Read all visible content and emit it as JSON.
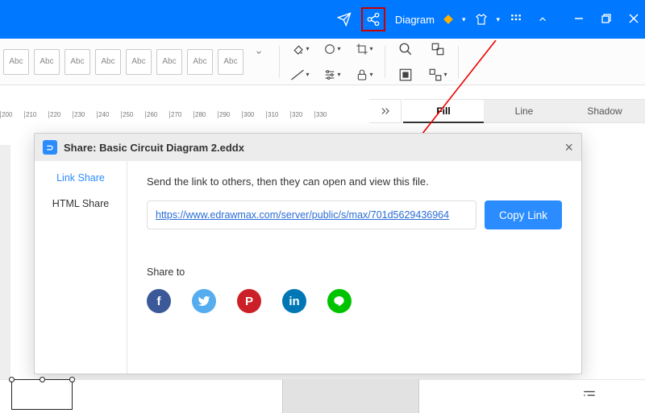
{
  "titlebar": {
    "diagram_label": "Diagram"
  },
  "ribbon": {
    "abc_label": "Abc",
    "abc_count": 8
  },
  "ruler": [
    "200",
    "210",
    "220",
    "230",
    "240",
    "250",
    "260",
    "270",
    "280",
    "290",
    "300",
    "310",
    "320",
    "330"
  ],
  "sidepanel": {
    "tabs": {
      "fill": "Fill",
      "line": "Line",
      "shadow": "Shadow"
    }
  },
  "modal": {
    "title": "Share: Basic Circuit Diagram 2.eddx",
    "nav": {
      "link": "Link Share",
      "html": "HTML Share"
    },
    "instruction": "Send the link to others, then they can open and view this file.",
    "url": "https://www.edrawmax.com/server/public/s/max/701d5629436964",
    "copy_label": "Copy Link",
    "share_to": "Share to"
  }
}
